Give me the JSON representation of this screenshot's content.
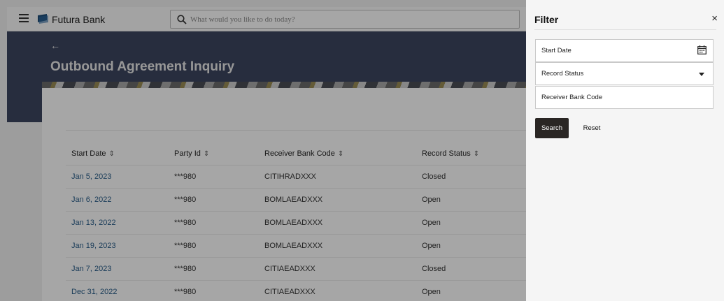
{
  "header": {
    "brand": "Futura Bank",
    "search_placeholder": "What would you like to do today?"
  },
  "hero": {
    "back_arrow": "←",
    "title": "Outbound Agreement Inquiry"
  },
  "table": {
    "columns": [
      "Start Date",
      "Party Id",
      "Receiver Bank Code",
      "Record Status"
    ],
    "rows": [
      [
        "Jan 5, 2023",
        "***980",
        "CITIHRADXXX",
        "Closed"
      ],
      [
        "Jan 6, 2022",
        "***980",
        "BOMLAEADXXX",
        "Open"
      ],
      [
        "Jan 13, 2022",
        "***980",
        "BOMLAEADXXX",
        "Open"
      ],
      [
        "Jan 19, 2023",
        "***980",
        "BOMLAEADXXX",
        "Open"
      ],
      [
        "Jan 7, 2023",
        "***980",
        "CITIAEADXXX",
        "Closed"
      ],
      [
        "Dec 31, 2022",
        "***980",
        "CITIAEADXXX",
        "Open"
      ]
    ],
    "sort_glyph": "⇕"
  },
  "filter": {
    "title": "Filter",
    "close": "×",
    "start_date_label": "Start Date",
    "record_status_label": "Record Status",
    "receiver_bank_code_label": "Receiver Bank Code",
    "search_label": "Search",
    "reset_label": "Reset"
  },
  "colors": {
    "hero_bg": "#3d4560",
    "link": "#2b5f8a",
    "primary_button": "#2a2624"
  },
  "icons": [
    "hamburger-menu-icon",
    "bank-logo-icon",
    "search-icon",
    "back-arrow-icon",
    "sort-icon",
    "close-icon",
    "calendar-icon",
    "chevron-down-icon"
  ]
}
